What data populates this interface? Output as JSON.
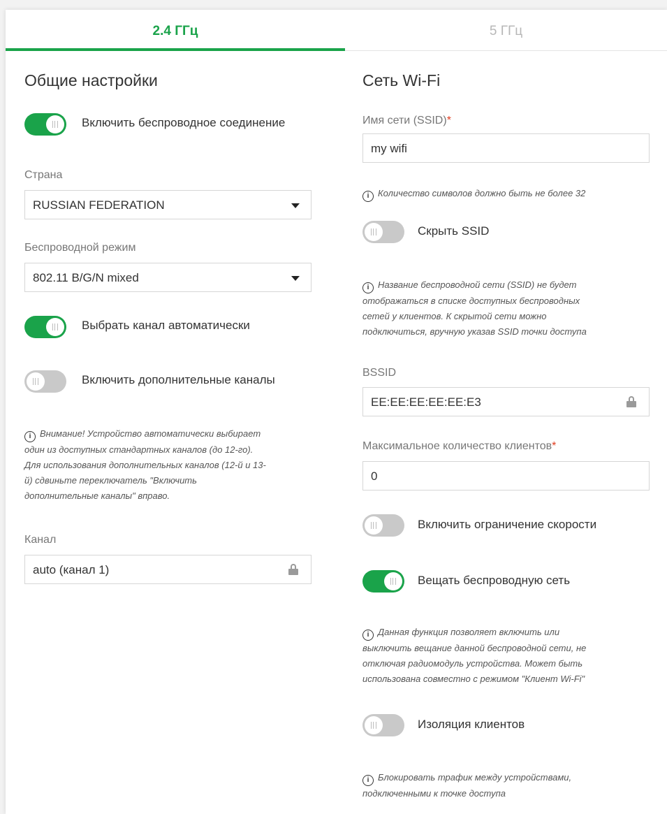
{
  "tabs": [
    {
      "label": "2.4 ГГц"
    },
    {
      "label": "5 ГГц"
    }
  ],
  "left": {
    "title": "Общие настройки",
    "enable_wireless": {
      "label": "Включить беспроводное соединение",
      "state": "on"
    },
    "country": {
      "label": "Страна",
      "value": "RUSSIAN FEDERATION"
    },
    "mode": {
      "label": "Беспроводной режим",
      "value": "802.11 B/G/N mixed"
    },
    "auto_channel": {
      "label": "Выбрать канал автоматически",
      "state": "on"
    },
    "extra_channels": {
      "label": "Включить дополнительные каналы",
      "state": "off"
    },
    "note_lines": [
      "Внимание! Устройство автоматически выбирает",
      "один из доступных стандартных каналов (до 12-го).",
      "Для использования дополнительных каналов (12-й и 13-",
      "й) сдвиньте переключатель \"Включить",
      "дополнительные каналы\" вправо."
    ],
    "channel": {
      "label": "Канал",
      "value": "auto (канал 1)"
    }
  },
  "right": {
    "title": "Сеть Wi-Fi",
    "ssid": {
      "label": "Имя сети (SSID)",
      "required": "*",
      "value": "my wifi"
    },
    "ssid_note": "Количество символов должно быть не более 32",
    "hide_ssid": {
      "label": "Скрыть SSID",
      "state": "off"
    },
    "hide_note_lines": [
      "Название беспроводной сети (SSID) не будет",
      "отображаться в списке доступных беспроводных",
      "сетей у клиентов. К скрытой сети можно",
      "подключиться, вручную указав SSID точки доступа"
    ],
    "bssid": {
      "label": "BSSID",
      "value": "EE:EE:EE:EE:EE:E3"
    },
    "max_clients": {
      "label": "Максимальное количество клиентов",
      "required": "*",
      "value": "0"
    },
    "speed_limit": {
      "label": "Включить ограничение скорости",
      "state": "off"
    },
    "broadcast": {
      "label": "Вещать беспроводную сеть",
      "state": "on"
    },
    "broadcast_note_lines": [
      "Данная функция позволяет включить или",
      "выключить вещание данной беспроводной сети, не",
      "отключая радиомодуль устройства. Может быть",
      "использована совместно с режимом \"Клиент Wi-Fi\""
    ],
    "isolation": {
      "label": "Изоляция клиентов",
      "state": "off"
    },
    "isolation_note_lines": [
      "Блокировать трафик между устройствами,",
      "подключенными к точке доступа"
    ]
  },
  "icons": {
    "info": "info-icon",
    "lock": "lock-icon",
    "dropdown": "caret-down-icon"
  },
  "colors": {
    "accent": "#1aa34a",
    "required": "#e03c1f",
    "toggle_off": "#c9c9c9"
  }
}
